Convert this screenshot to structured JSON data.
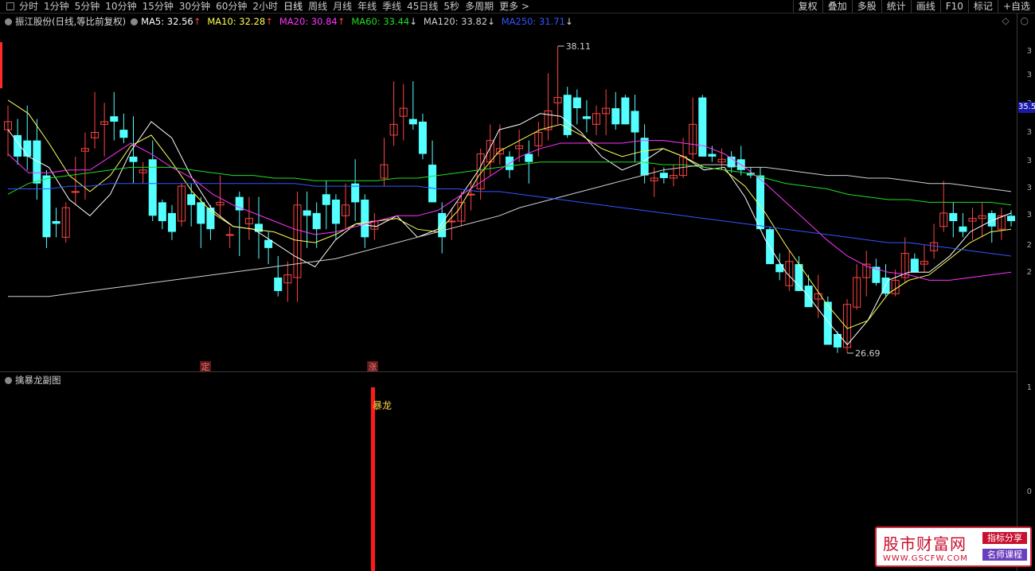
{
  "toolbar": {
    "periods": [
      "分时",
      "1分钟",
      "5分钟",
      "10分钟",
      "15分钟",
      "30分钟",
      "60分钟",
      "2小时",
      "日线",
      "周线",
      "月线",
      "年线",
      "季线",
      "45日线",
      "5秒",
      "多周期",
      "更多 >"
    ],
    "active_period": "日线",
    "right_buttons": [
      "复权",
      "叠加",
      "多股",
      "统计",
      "画线",
      "F10",
      "标记",
      "+自选"
    ]
  },
  "legend": {
    "title": "振江股份(日线,等比前复权)",
    "ma": [
      {
        "label": "MA5: 32.56",
        "arrow": "↑",
        "color": "#ffffff"
      },
      {
        "label": "MA10: 32.28",
        "arrow": "↑",
        "color": "#ffff55"
      },
      {
        "label": "MA20: 30.84",
        "arrow": "↑",
        "color": "#ff33ff"
      },
      {
        "label": "MA60: 33.44",
        "arrow": "↓",
        "color": "#22dd22"
      },
      {
        "label": "MA120: 33.82",
        "arrow": "↓",
        "color": "#d0d0d0"
      },
      {
        "label": "MA250: 31.71",
        "arrow": "↓",
        "color": "#3355ff"
      }
    ]
  },
  "main_chart": {
    "high_label": "38.11",
    "low_label": "26.69",
    "current_price": "35.5",
    "signal_labels": [
      "定",
      "涨"
    ],
    "axis_ticks": [
      "3",
      "3",
      "3",
      "3",
      "3",
      "3",
      "3",
      "2",
      "2"
    ]
  },
  "sub_chart": {
    "title": "擒暴龙副图",
    "signal_text": "暴龙",
    "axis_ticks": [
      "1",
      "0"
    ]
  },
  "watermark": {
    "title": "股市财富网",
    "url": "WWW.GSCFW.COM",
    "tag1": "指标分享",
    "tag2": "名师课程"
  },
  "colors": {
    "up": "#ff4444",
    "down": "#54ffff",
    "ma5": "#ffffff",
    "ma10": "#ffff55",
    "ma20": "#ff33ff",
    "ma60": "#22dd22",
    "ma120": "#d0d0d0",
    "ma250": "#3355ff"
  }
}
